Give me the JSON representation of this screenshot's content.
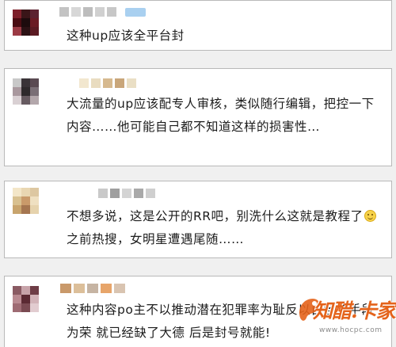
{
  "comments": [
    {
      "text": "这种up应该全平台封",
      "avatar_colors": [
        "#7d1f2a",
        "#3a1518",
        "#5c2230",
        "#4a0c12",
        "#1d0b0d",
        "#6a1b24",
        "#9b3a44",
        "#2b1114",
        "#5a1a22"
      ],
      "name_colors": [
        "#c3c3c3",
        "#d7d7d7",
        "#bdbdbd",
        "#d0d0d0",
        "#c7c7c7"
      ],
      "badge_color": "#a9d0f0"
    },
    {
      "text": "大流量的up应该配专人审核，类似随行编辑，把控一下内容……他可能自己都不知道这样的损害性…",
      "avatar_colors": [
        "#c8c8c8",
        "#3a3438",
        "#5a4a52",
        "#a9989e",
        "#2e2a2c",
        "#7a6f76",
        "#d9d0d3",
        "#675b61",
        "#b3a7ab"
      ],
      "name_colors": [
        "#f2e7cf",
        "#e9dcc0",
        "#d6b98f",
        "#c9a67a",
        "#eadfc5"
      ]
    },
    {
      "text": "不想多说，这是公开的RR吧，别洗什么这就是教程了",
      "text_after_emoji": "之前热搜，女明星遭遇尾随……",
      "emoji": "smiley-face",
      "avatar_colors": [
        "#f3e6c8",
        "#e9d7b2",
        "#ddc7a1",
        "#d8c08f",
        "#c99a6a",
        "#efe0c1",
        "#c8a46d",
        "#a57650",
        "#e6d3ad"
      ],
      "name_colors": [
        "#c9c9c9",
        "#9f9f9f",
        "#d4d4d4",
        "#a9a9a9",
        "#cfcfcf"
      ]
    },
    {
      "text": "这种内容po主不以推动潜在犯罪率为耻反以自各的手段为荣 就已经缺了大德 后是封号就能!",
      "avatar_colors": [
        "#8a5b63",
        "#c7a3a9",
        "#6e3d46",
        "#b98a91",
        "#5b2a33",
        "#d2b3b8",
        "#9e6b73",
        "#7a4a52",
        "#e2ccd0"
      ],
      "name_colors": [
        "#c9996a",
        "#dcbf9a",
        "#c6b4a3",
        "#e7a56a",
        "#d9c4b1"
      ]
    }
  ],
  "watermark": {
    "title": "知醋.卡家",
    "url": "www.hocpc.com",
    "color": "#e4631b"
  }
}
